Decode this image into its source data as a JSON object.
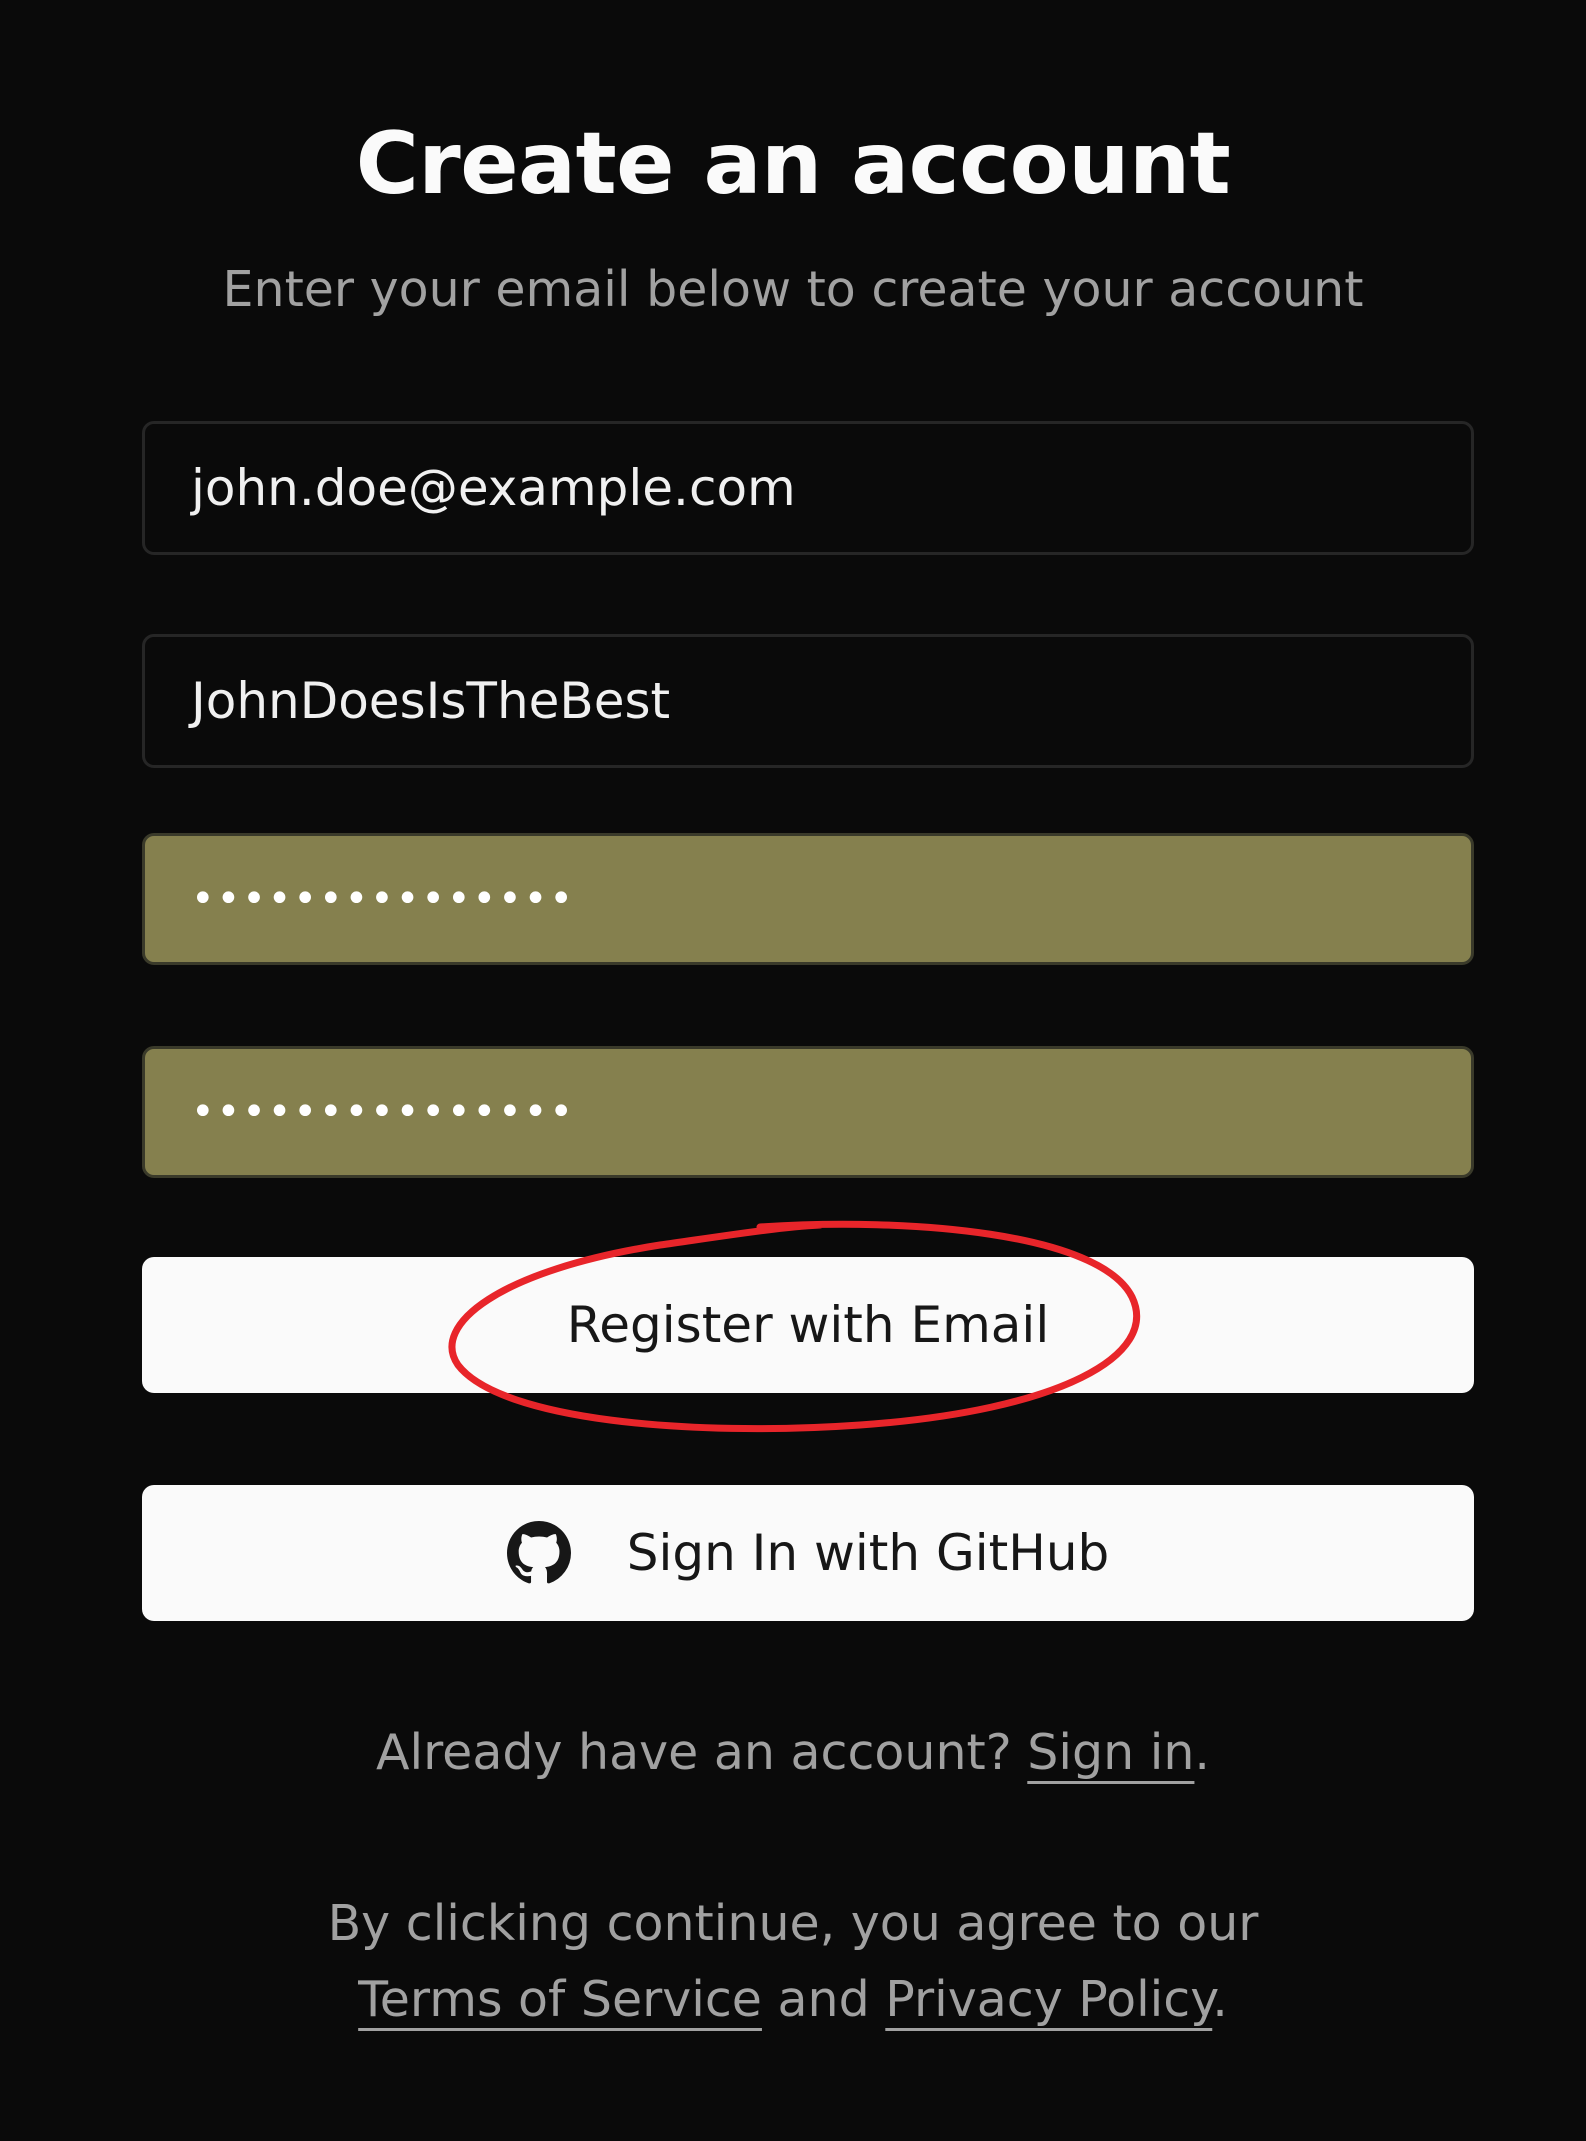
{
  "header": {
    "title": "Create an account",
    "subtitle": "Enter your email below to create your account"
  },
  "form": {
    "email_value": "john.doe@example.com",
    "username_value": "JohnDoesIsTheBest",
    "password_value": "•••••••••••••••",
    "confirm_password_value": "•••••••••••••••",
    "autofill_color": "#85804e"
  },
  "buttons": {
    "register_label": "Register with Email",
    "github_label": "Sign In with GitHub",
    "github_icon": "github-icon"
  },
  "footer": {
    "signin_prompt": "Already have an account? ",
    "signin_link": "Sign in",
    "signin_suffix": ".",
    "agree_text": "By clicking continue, you agree to our",
    "terms_link": "Terms of Service",
    "and_text": " and ",
    "privacy_link": "Privacy Policy",
    "end_period": "."
  },
  "annotation": {
    "highlight_color": "#e8252a"
  }
}
